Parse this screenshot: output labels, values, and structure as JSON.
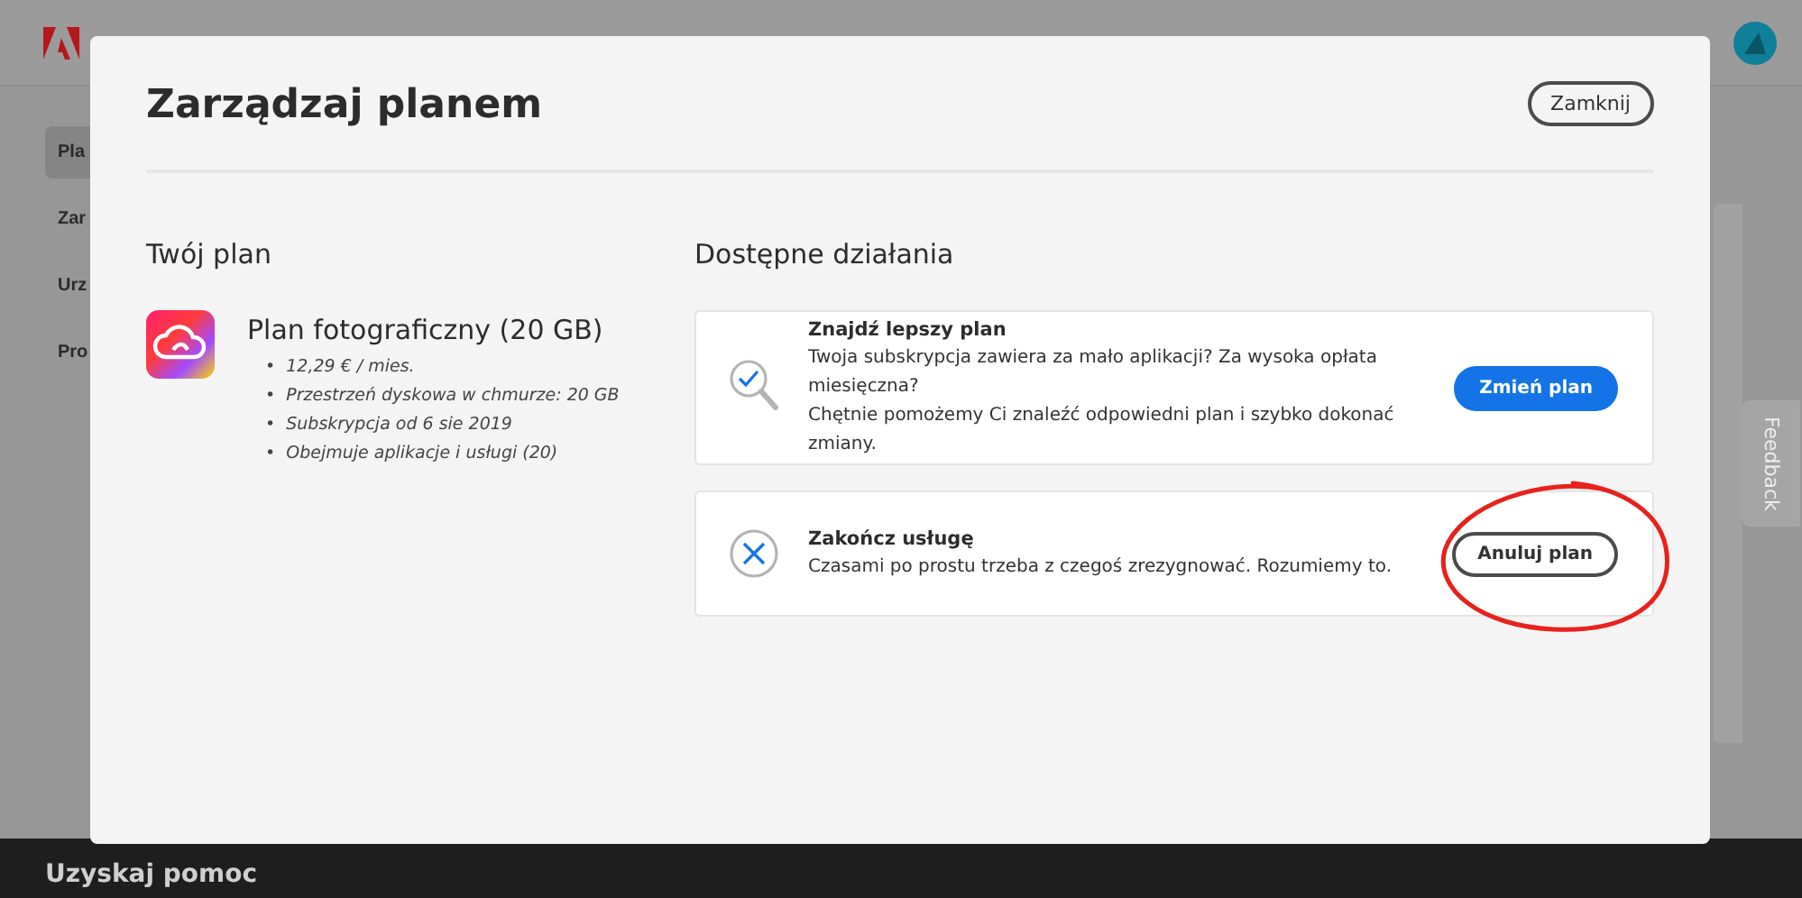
{
  "sidebar": {
    "items": [
      {
        "label": "Pla",
        "selected": true
      },
      {
        "label": "Zar",
        "selected": false
      },
      {
        "label": "Urz",
        "selected": false
      },
      {
        "label": "Pro",
        "selected": false
      }
    ]
  },
  "dialog": {
    "title": "Zarządzaj planem",
    "close_button": "Zamknij",
    "plan": {
      "heading": "Twój plan",
      "name": "Plan fotograficzny (20 GB)",
      "bullet": "•",
      "details": [
        "12,29 € / mies.",
        "Przestrzeń dyskowa w chmurze: 20 GB",
        "Subskrypcja od 6 sie 2019",
        "Obejmuje aplikacje i usługi (20)"
      ]
    },
    "actions": {
      "heading": "Dostępne działania",
      "items": [
        {
          "kind": "search",
          "title": "Znajdź lepszy plan",
          "lines": [
            "Twoja subskrypcja zawiera za mało aplikacji? Za wysoka opłata miesięczna?",
            "Chętnie pomożemy Ci znaleźć odpowiedni plan i szybko dokonać zmiany."
          ],
          "button": "Zmień plan",
          "primary": true,
          "circled": false
        },
        {
          "kind": "cancel",
          "title": "Zakończ usługę",
          "lines": [
            "Czasami po prostu trzeba z czegoś zrezygnować. Rozumiemy to."
          ],
          "button": "Anuluj plan",
          "primary": false,
          "circled": true
        }
      ]
    }
  },
  "feedback_tab": "Feedback",
  "footer": {
    "heading": "Uzyskaj pomoc"
  }
}
